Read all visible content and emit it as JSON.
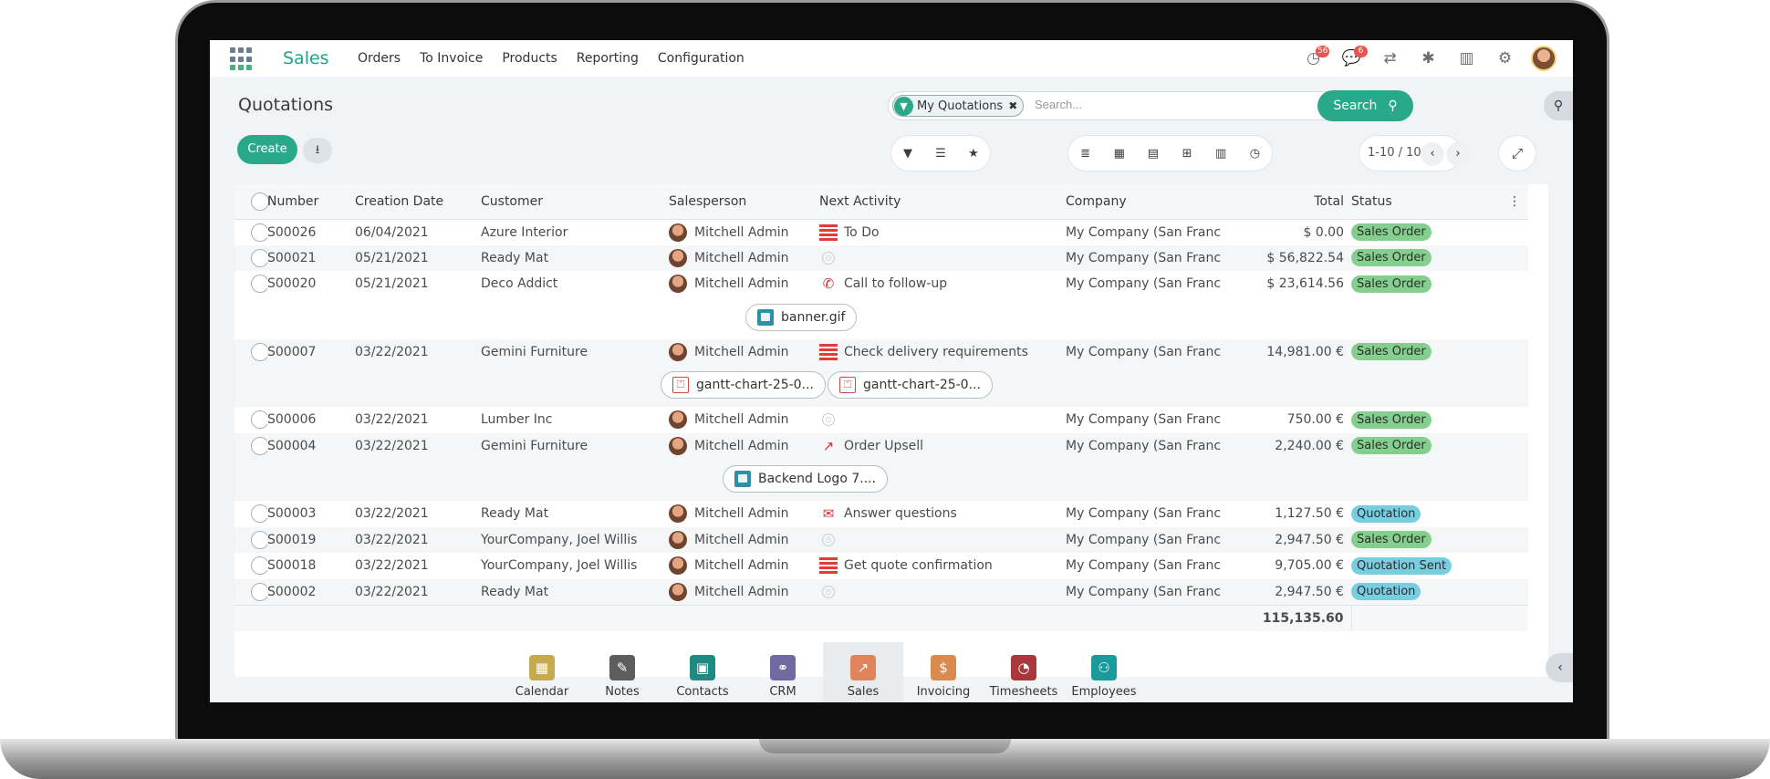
{
  "navbar": {
    "brand": "Sales",
    "menu": [
      "Orders",
      "To Invoice",
      "Products",
      "Reporting",
      "Configuration"
    ],
    "activity_count": "56",
    "message_count": "6"
  },
  "control_panel": {
    "title": "Quotations",
    "create_label": "Create",
    "facet_label": "My Quotations",
    "search_placeholder": "Search...",
    "search_button": "Search",
    "pager": "1-10 / 10"
  },
  "table": {
    "headers": [
      "Number",
      "Creation Date",
      "Customer",
      "Salesperson",
      "Next Activity",
      "Company",
      "Total",
      "Status"
    ],
    "rows": [
      {
        "number": "S00026",
        "date": "06/04/2021",
        "customer": "Azure Interior",
        "salesperson": "Mitchell Admin",
        "activity": "To Do",
        "activity_icon": "todo-icon",
        "company": "My Company (San Francisco)",
        "total": "$ 0.00",
        "status": "Sales Order"
      },
      {
        "number": "S00021",
        "date": "05/21/2021",
        "customer": "Ready Mat",
        "salesperson": "Mitchell Admin",
        "activity": "",
        "activity_icon": "clock-icon",
        "company": "My Company (San Francisco)",
        "total": "$ 56,822.54",
        "status": "Sales Order"
      },
      {
        "number": "S00020",
        "date": "05/21/2021",
        "customer": "Deco Addict",
        "salesperson": "Mitchell Admin",
        "activity": "Call to follow-up",
        "activity_icon": "phone-icon",
        "company": "My Company (San Francisco)",
        "total": "$ 23,614.56",
        "status": "Sales Order",
        "attachments": [
          "banner.gif"
        ]
      },
      {
        "number": "S00007",
        "date": "03/22/2021",
        "customer": "Gemini Furniture",
        "salesperson": "Mitchell Admin",
        "activity": "Check delivery requirements",
        "activity_icon": "todo-icon",
        "company": "My Company (San Francisco)",
        "total": "14,981.00 €",
        "status": "Sales Order",
        "attachments": [
          "gantt-chart-25-0...",
          "gantt-chart-25-0..."
        ]
      },
      {
        "number": "S00006",
        "date": "03/22/2021",
        "customer": "Lumber Inc",
        "salesperson": "Mitchell Admin",
        "activity": "",
        "activity_icon": "clock-icon",
        "company": "My Company (San Francisco)",
        "total": "750.00 €",
        "status": "Sales Order"
      },
      {
        "number": "S00004",
        "date": "03/22/2021",
        "customer": "Gemini Furniture",
        "salesperson": "Mitchell Admin",
        "activity": "Order Upsell",
        "activity_icon": "upsell-chart-icon",
        "company": "My Company (San Francisco)",
        "total": "2,240.00 €",
        "status": "Sales Order",
        "attachments": [
          "Backend Logo 7...."
        ]
      },
      {
        "number": "S00003",
        "date": "03/22/2021",
        "customer": "Ready Mat",
        "salesperson": "Mitchell Admin",
        "activity": "Answer questions",
        "activity_icon": "envelope-icon",
        "company": "My Company (San Francisco)",
        "total": "1,127.50 €",
        "status": "Quotation"
      },
      {
        "number": "S00019",
        "date": "03/22/2021",
        "customer": "YourCompany, Joel Willis",
        "salesperson": "Mitchell Admin",
        "activity": "",
        "activity_icon": "clock-icon",
        "company": "My Company (San Francisco)",
        "total": "2,947.50 €",
        "status": "Sales Order"
      },
      {
        "number": "S00018",
        "date": "03/22/2021",
        "customer": "YourCompany, Joel Willis",
        "salesperson": "Mitchell Admin",
        "activity": "Get quote confirmation",
        "activity_icon": "todo-icon",
        "company": "My Company (San Francisco)",
        "total": "9,705.00 €",
        "status": "Quotation Sent"
      },
      {
        "number": "S00002",
        "date": "03/22/2021",
        "customer": "Ready Mat",
        "salesperson": "Mitchell Admin",
        "activity": "",
        "activity_icon": "clock-icon",
        "company": "My Company (San Francisco)",
        "total": "2,947.50 €",
        "status": "Quotation"
      }
    ],
    "footer_total": "115,135.60"
  },
  "dock": [
    {
      "label": "Calendar",
      "icon": "calendar-icon",
      "color": "#c7a94e"
    },
    {
      "label": "Notes",
      "icon": "notes-icon",
      "color": "#5d5d5d"
    },
    {
      "label": "Contacts",
      "icon": "contacts-icon",
      "color": "#1f8a82"
    },
    {
      "label": "CRM",
      "icon": "handshake-icon",
      "color": "#6f6aa0"
    },
    {
      "label": "Sales",
      "icon": "sales-chart-icon",
      "color": "#e0845c",
      "active": true
    },
    {
      "label": "Invoicing",
      "icon": "invoice-icon",
      "color": "#d98a4f"
    },
    {
      "label": "Timesheets",
      "icon": "stopwatch-icon",
      "color": "#a8383c"
    },
    {
      "label": "Employees",
      "icon": "employees-icon",
      "color": "#1a9a9a"
    }
  ],
  "colors": {
    "accent": "#2aa88a",
    "sales_order_badge": "#84cf8e",
    "quotation_badge": "#79cde0"
  }
}
